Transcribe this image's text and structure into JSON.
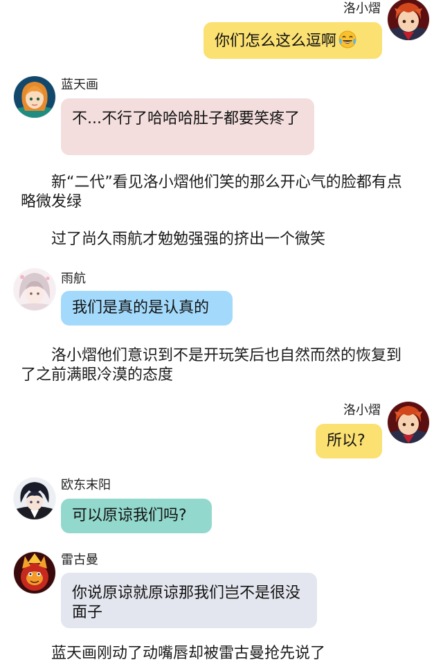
{
  "messages": [
    {
      "speaker": "洛小熠",
      "text": "你们怎么这么逗啊",
      "emoji": "laughing-tears-icon",
      "side": "right",
      "color": "#fbe072"
    },
    {
      "speaker": "蓝天画",
      "text": "不...不行了哈哈哈肚子都要笑疼了",
      "side": "left",
      "color": "#f3dedd"
    },
    {
      "speaker": "雨航",
      "text": "我们是真的是认真的",
      "side": "left",
      "color": "#a3d9fb"
    },
    {
      "speaker": "洛小熠",
      "text": "所以?",
      "side": "right",
      "color": "#fbe072"
    },
    {
      "speaker": "欧东末阳",
      "text": "可以原谅我们吗?",
      "side": "left",
      "color": "#93d8cc"
    },
    {
      "speaker": "雷古曼",
      "text": "你说原谅就原谅那我们岂不是很没面子",
      "side": "left",
      "color": "#e3e6ef"
    }
  ],
  "narration": [
    "新“二代”看见洛小熠他们笑的那么开心气的脸都有点略微发绿",
    "过了尚久雨航才勉勉强强的挤出一个微笑",
    "洛小熠他们意识到不是开玩笑后也自然而然的恢复到了之前满眼冷漠的态度",
    "蓝天画刚动了动嘴唇却被雷古曼抢先说了"
  ]
}
